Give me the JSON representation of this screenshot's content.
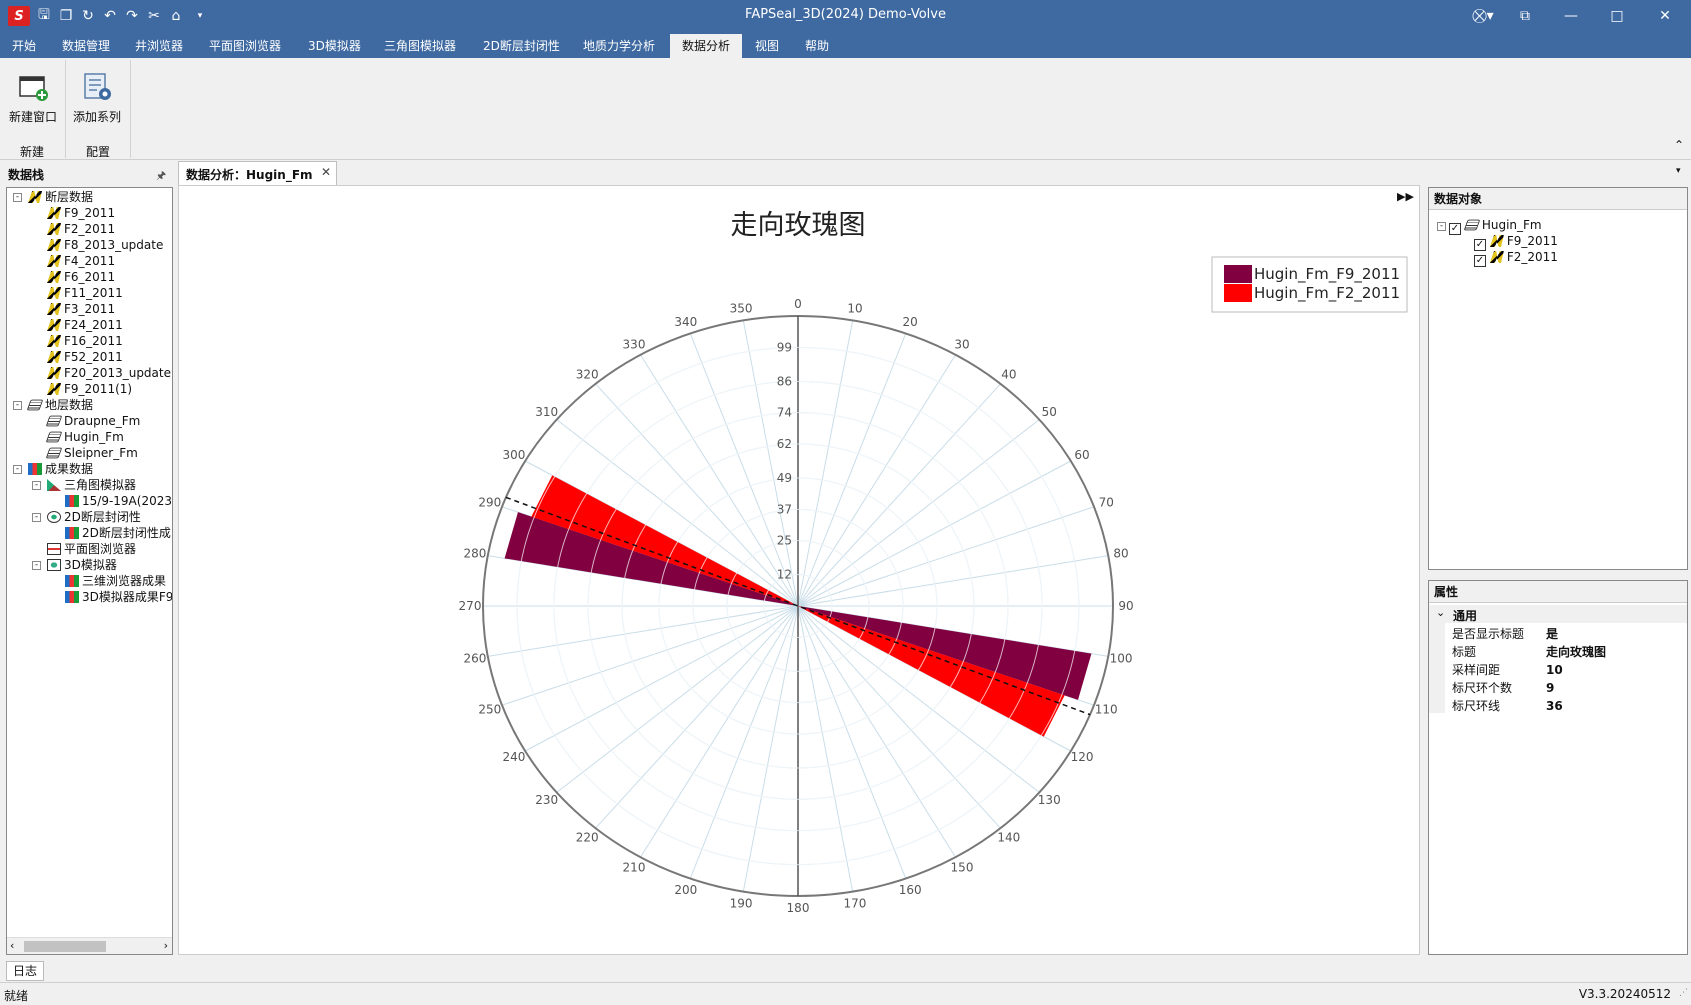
{
  "app": {
    "title": "FAPSeal_3D(2024) Demo-Volve"
  },
  "menu": {
    "items": [
      "开始",
      "数据管理",
      "井浏览器",
      "平面图浏览器",
      "3D模拟器",
      "三角图模拟器",
      "2D断层封闭性",
      "地质力学分析",
      "数据分析",
      "视图",
      "帮助"
    ],
    "active_index": 8
  },
  "ribbon": {
    "new_window": "新建窗口",
    "add_series": "添加系列",
    "group_new": "新建",
    "group_config": "配置"
  },
  "data_stack": {
    "title": "数据栈",
    "fault_group": "断层数据",
    "faults": [
      "F9_2011",
      "F2_2011",
      "F8_2013_update",
      "F4_2011",
      "F6_2011",
      "F11_2011",
      "F3_2011",
      "F24_2011",
      "F16_2011",
      "F52_2011",
      "F20_2013_update",
      "F9_2011(1)"
    ],
    "layer_group": "地层数据",
    "layers": [
      "Draupne_Fm",
      "Hugin_Fm",
      "Sleipner_Fm"
    ],
    "result_group": "成果数据",
    "results": [
      {
        "name": "三角图模拟器",
        "child": "15/9-19A(2023"
      },
      {
        "name": "2D断层封闭性",
        "child": "2D断层封闭性成"
      },
      {
        "name": "平面图浏览器",
        "child": ""
      },
      {
        "name": "3D模拟器",
        "children": [
          "三维浏览器成果",
          "3D模拟器成果F9"
        ]
      }
    ]
  },
  "doc_tab": {
    "label": "数据分析：Hugin_Fm"
  },
  "chart_data": {
    "type": "rose",
    "title": "走向玫瑰图",
    "angle_ticks": [
      0,
      10,
      20,
      30,
      40,
      50,
      60,
      70,
      80,
      90,
      100,
      110,
      120,
      130,
      140,
      150,
      160,
      170,
      180,
      190,
      200,
      210,
      220,
      230,
      240,
      250,
      260,
      270,
      280,
      290,
      300,
      310,
      320,
      330,
      340,
      350
    ],
    "radial_ticks": [
      12,
      25,
      37,
      49,
      62,
      74,
      86,
      99
    ],
    "radial_max": 111,
    "series": [
      {
        "name": "Hugin_Fm_F9_2011",
        "color": "#800040",
        "bin_start": 100,
        "bin_end": 110,
        "value": 105
      },
      {
        "name": "Hugin_Fm_F2_2011",
        "color": "#ff0000",
        "bin_start": 110,
        "bin_end": 120,
        "value": 100
      }
    ],
    "mean_direction": 112,
    "legend_position": "top-right"
  },
  "data_objects": {
    "title": "数据对象",
    "root": "Hugin_Fm",
    "children": [
      "F9_2011",
      "F2_2011"
    ]
  },
  "properties": {
    "title": "属性",
    "category": "通用",
    "rows": [
      {
        "k": "是否显示标题",
        "v": "是"
      },
      {
        "k": "标题",
        "v": "走向玫瑰图"
      },
      {
        "k": "采样间距",
        "v": "10"
      },
      {
        "k": "标尺环个数",
        "v": "9"
      },
      {
        "k": "标尺环线",
        "v": "36"
      }
    ]
  },
  "bottom_tab": {
    "label": "日志"
  },
  "status": {
    "left": "就绪",
    "right": "V3.3.20240512"
  }
}
